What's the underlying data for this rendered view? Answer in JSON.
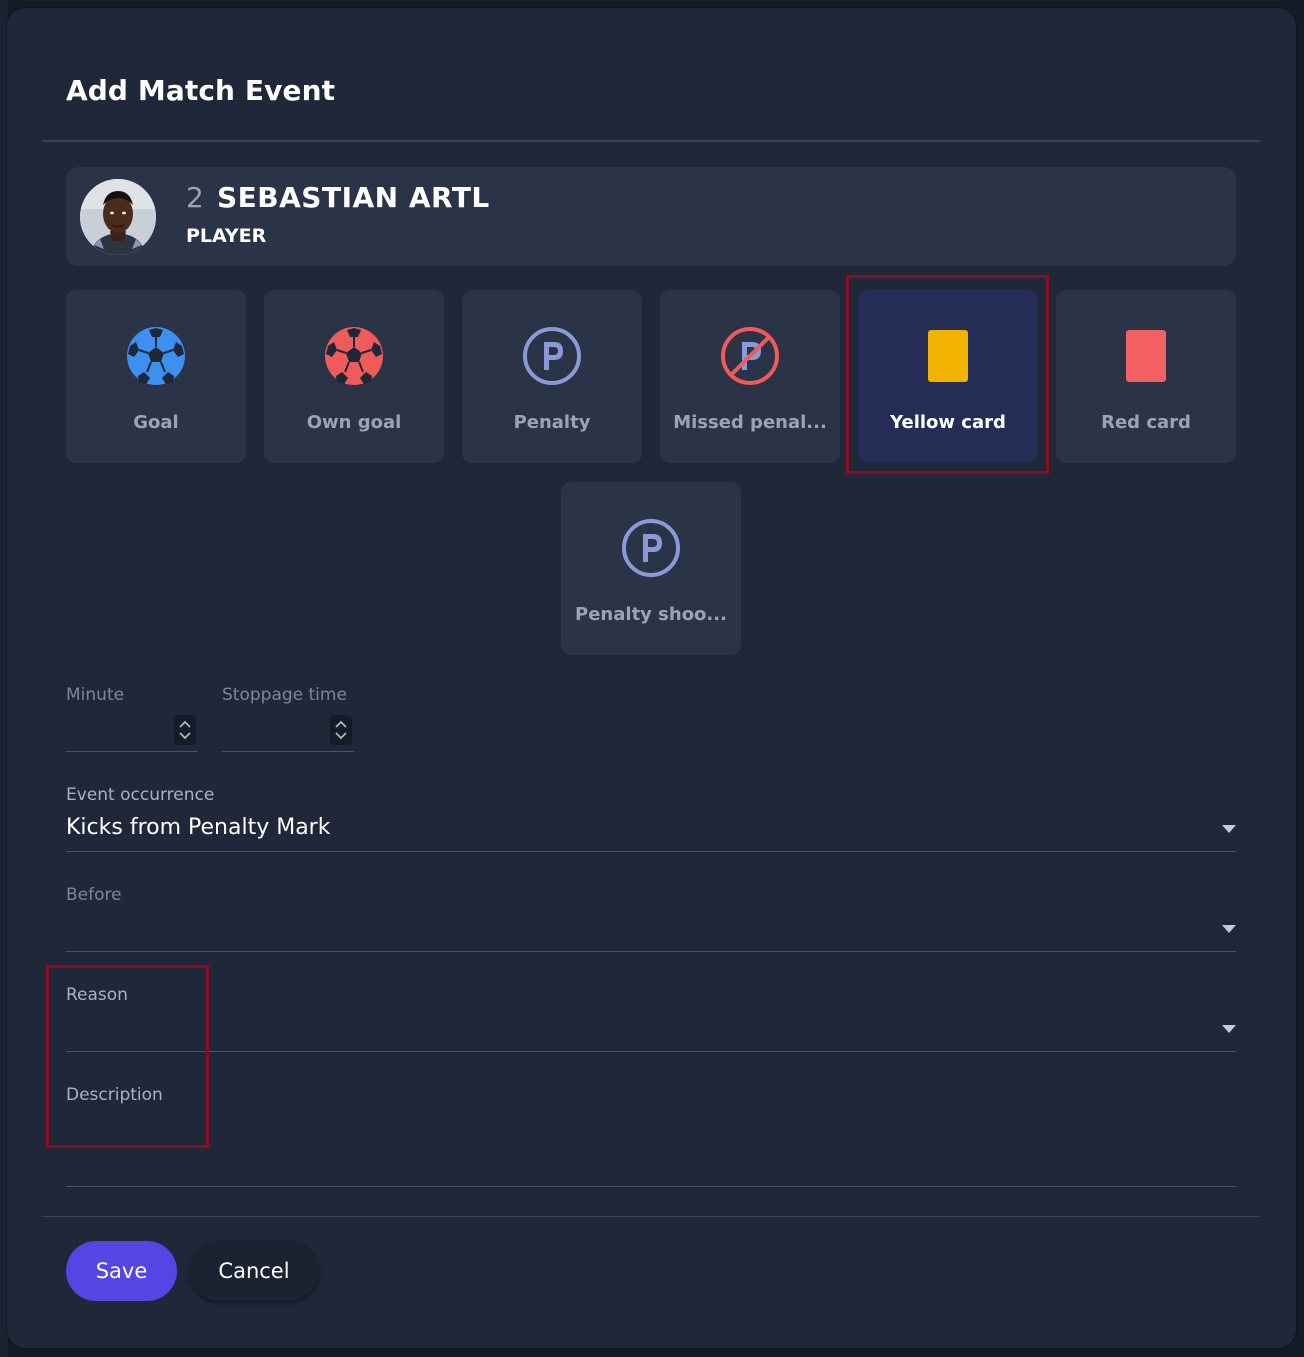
{
  "dialog": {
    "title": "Add Match Event"
  },
  "player": {
    "number": "2",
    "name": "SEBASTIAN ARTL",
    "role": "PLAYER"
  },
  "events": [
    {
      "label": "Goal",
      "icon": "soccer-ball-icon",
      "color": "#3d8ff0",
      "selected": false
    },
    {
      "label": "Own goal",
      "icon": "soccer-ball-icon",
      "color": "#ef5b5b",
      "selected": false
    },
    {
      "label": "Penalty",
      "icon": "penalty-p-icon",
      "color": "#8a9ad8",
      "selected": false
    },
    {
      "label": "Missed penal...",
      "icon": "missed-penalty-icon",
      "color": "#ef5b5b",
      "selected": false
    },
    {
      "label": "Yellow card",
      "icon": "yellow-card-icon",
      "color": "#f2b200",
      "selected": true
    },
    {
      "label": "Red card",
      "icon": "red-card-icon",
      "color": "#f36162",
      "selected": false
    },
    {
      "label": "Penalty shoo...",
      "icon": "penalty-p-icon",
      "color": "#8a9ad8",
      "selected": false
    }
  ],
  "fields": {
    "minute": {
      "label": "Minute",
      "value": ""
    },
    "stoppage": {
      "label": "Stoppage time",
      "value": ""
    },
    "occurrence": {
      "label": "Event occurrence",
      "value": "Kicks from Penalty Mark"
    },
    "before": {
      "label": "Before",
      "value": ""
    },
    "reason": {
      "label": "Reason",
      "value": ""
    },
    "description": {
      "label": "Description",
      "value": ""
    }
  },
  "actions": {
    "save": "Save",
    "cancel": "Cancel"
  },
  "colors": {
    "modal_bg": "#1f2738",
    "card_bg": "#2a3446",
    "selected_bg": "#252d56",
    "primary": "#5346e5",
    "highlight": "#8b0d24"
  }
}
